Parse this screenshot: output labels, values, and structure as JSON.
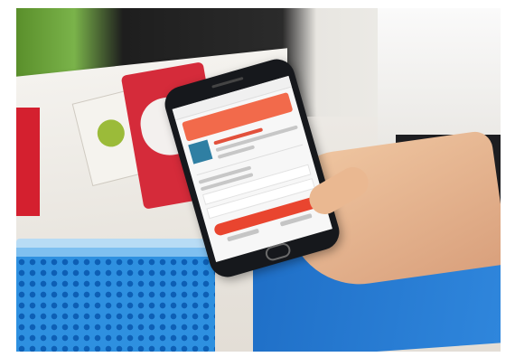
{
  "scene": {
    "subject": "smartphone-payment-photo",
    "colors": {
      "phone_body": "#16181c",
      "pay_button": "#e9452f",
      "promo_banner": "#f26a4b",
      "sticker_red": "#d52b3a",
      "basket_blue": "#2e90e0",
      "banner_blue": "#1f6fc7",
      "skin": "#e7b58e"
    },
    "icons": [
      "cloud-sticker-icon",
      "qr-code-icon"
    ]
  }
}
